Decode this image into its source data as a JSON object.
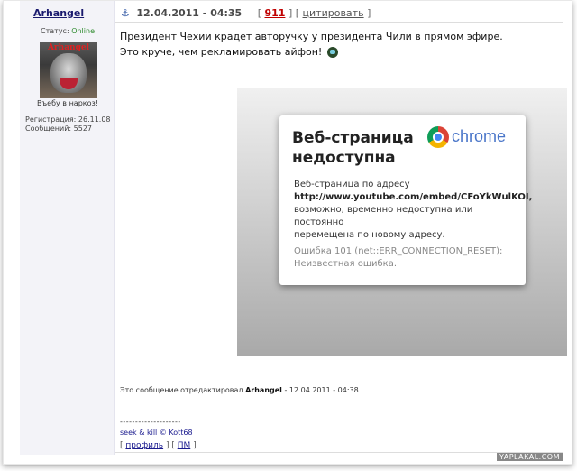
{
  "post": {
    "username": "Arhangel",
    "anchor_icon": "⚓",
    "date": "12.04.2011 - 04:35",
    "post_number": "911",
    "cite_label": "цитировать",
    "bracket_open": "[",
    "bracket_close": "]"
  },
  "user": {
    "status_label": "Статус:",
    "status_value": "Online",
    "avatar_title": "Arhangel",
    "motto": "Въебу в наркоз!",
    "registration": "Регистрация: 26.11.08",
    "messages": "Сообщений: 5527"
  },
  "message": {
    "line1": "Президент Чехии крадет авторучку у президента Чили в прямом эфире.",
    "line2": "Это круче, чем рекламировать айфон!"
  },
  "embed": {
    "title_line1": "Веб-страница",
    "title_line2": "недоступна",
    "brand": "chrome",
    "body_line1": "Веб-страница по адресу",
    "url": "http://www.youtube.com/embed/CFoYkWulKOI",
    "body_line3": "возможно, временно недоступна или постоянно",
    "body_line4": "перемещена по новому адресу.",
    "error_line1": "Ошибка 101 (net::ERR_CONNECTION_RESET):",
    "error_line2": "Неизвестная ошибка."
  },
  "edited": {
    "prefix": "Это сообщение отредактировал",
    "editor": "Arhangel",
    "suffix": "- 12.04.2011 - 04:38"
  },
  "signature": {
    "divider": "--------------------",
    "text": "seek & kill © Kott68"
  },
  "actions": {
    "profile": "профиль",
    "pm": "ПМ"
  },
  "watermark": "YAPLAKAL.COM"
}
